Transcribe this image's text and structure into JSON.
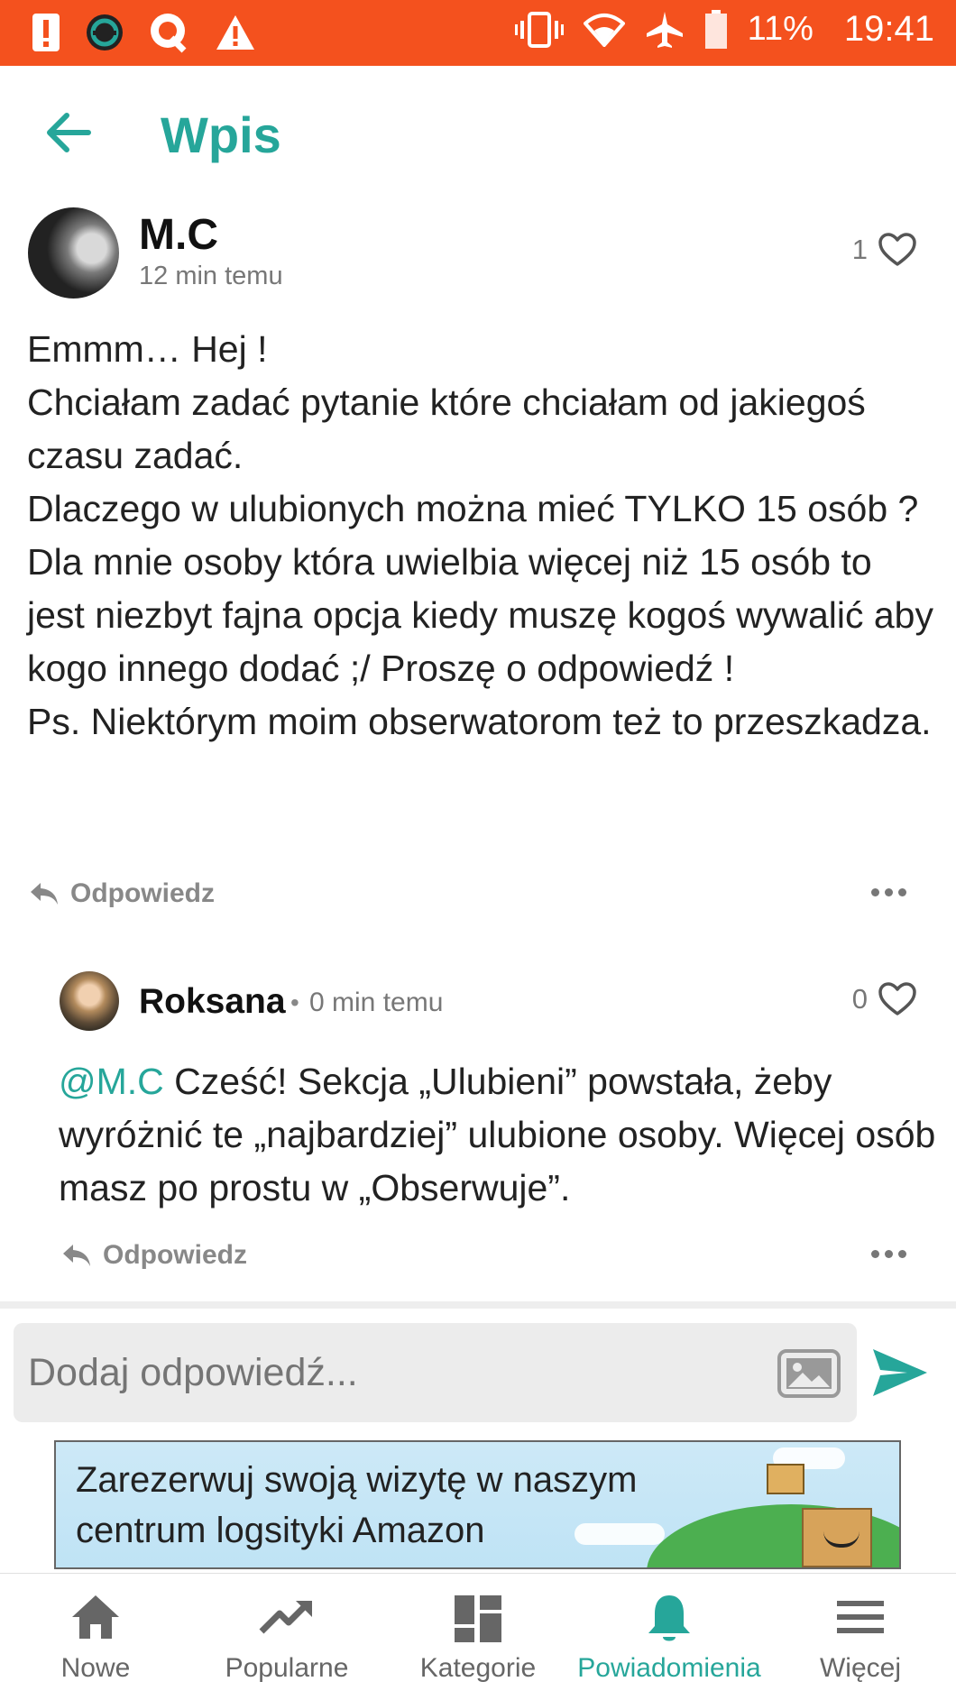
{
  "status_bar": {
    "battery": "11%",
    "time": "19:41"
  },
  "app_bar": {
    "title": "Wpis"
  },
  "post": {
    "author": "M.C",
    "time": "12 min temu",
    "likes": "1",
    "body": [
      "Emmm… Hej !",
      "Chciałam zadać pytanie które chciałam od jakiegoś czasu zadać.",
      "Dlaczego w ulubionych można mieć TYLKO 15 osób ? Dla mnie osoby która uwielbia więcej niż 15 osób to jest niezbyt fajna opcja kiedy muszę kogoś wywalić aby kogo innego dodać ;/ Proszę o odpowiedź !",
      "Ps. Niektórym moim obserwatorom też to przeszkadza."
    ],
    "reply_label": "Odpowiedz"
  },
  "comment": {
    "author": "Roksana",
    "separator": "•",
    "time": "0 min temu",
    "likes": "0",
    "mention": "@M.C",
    "text": " Cześć! Sekcja „Ulubieni” powstała, żeby wyróżnić te „najbardziej” ulubione osoby. Więcej osób masz po prostu w „Obserwuje”.",
    "reply_label": "Odpowiedz"
  },
  "reply_input": {
    "placeholder": "Dodaj odpowiedź..."
  },
  "ad": {
    "line1": "Zarezerwuj swoją wizytę w naszym",
    "line2": "centrum logsityki Amazon"
  },
  "bottom_nav": {
    "items": [
      {
        "label": "Nowe",
        "icon": "home-icon"
      },
      {
        "label": "Popularne",
        "icon": "trending-icon"
      },
      {
        "label": "Kategorie",
        "icon": "grid-icon"
      },
      {
        "label": "Powiadomienia",
        "icon": "bell-icon",
        "active": true
      },
      {
        "label": "Więcej",
        "icon": "menu-icon"
      }
    ]
  },
  "colors": {
    "status_bar": "#f4511e",
    "accent": "#26a69a"
  }
}
